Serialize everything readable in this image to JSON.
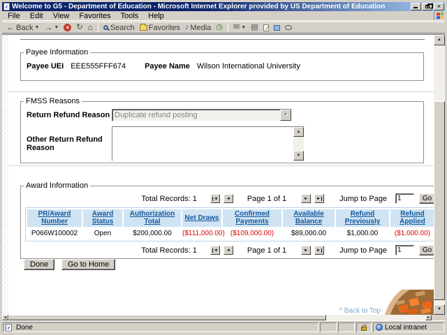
{
  "titlebar": {
    "title": "Welcome to G5 - Department of Education - Microsoft Internet Explorer provided by US Department of Education"
  },
  "menubar": {
    "items": [
      "File",
      "Edit",
      "View",
      "Favorites",
      "Tools",
      "Help"
    ]
  },
  "toolbar": {
    "back": "Back",
    "search": "Search",
    "favorites": "Favorites",
    "media": "Media"
  },
  "page": {
    "payee": {
      "legend": "Payee Information",
      "uei_label": "Payee UEI",
      "uei_value": "EEE555FFF674",
      "name_label": "Payee Name",
      "name_value": "Wilson International University"
    },
    "fmss": {
      "legend": "FMSS Reasons",
      "reason_label": "Return Refund Reason",
      "reason_value": "Duplicate refund posting",
      "other_label": "Other Return Refund Reason",
      "other_value": ""
    },
    "award": {
      "legend": "Award Information",
      "pagination": {
        "total": "Total Records: 1",
        "page": "Page 1 of 1",
        "jump_label": "Jump to Page",
        "jump_value": "1",
        "go": "Go"
      },
      "table": {
        "headers": [
          "PR/Award Number",
          "Award Status",
          "Authorization Total",
          "Net Draws",
          "Confirmed Payments",
          "Available Balance",
          "Refund Previously",
          "Refund Applied"
        ],
        "row": [
          "P066W100002",
          "Open",
          "$200,000.00",
          "($111,000.00)",
          "($109,000.00)",
          "$89,000.00",
          "$1,000.00",
          "($1,000.00)"
        ]
      }
    },
    "buttons": {
      "done": "Done",
      "go_home": "Go to Home"
    },
    "back_to_top": "^ Back to Top"
  },
  "statusbar": {
    "text": "Done",
    "zone": "Local intranet"
  },
  "colors": {
    "header_link": "#15589e",
    "negative_amount": "#e00000",
    "titlebar_start": "#0a246a",
    "titlebar_end": "#a6caf0",
    "header_cell_bg": "#cfe3f2"
  }
}
